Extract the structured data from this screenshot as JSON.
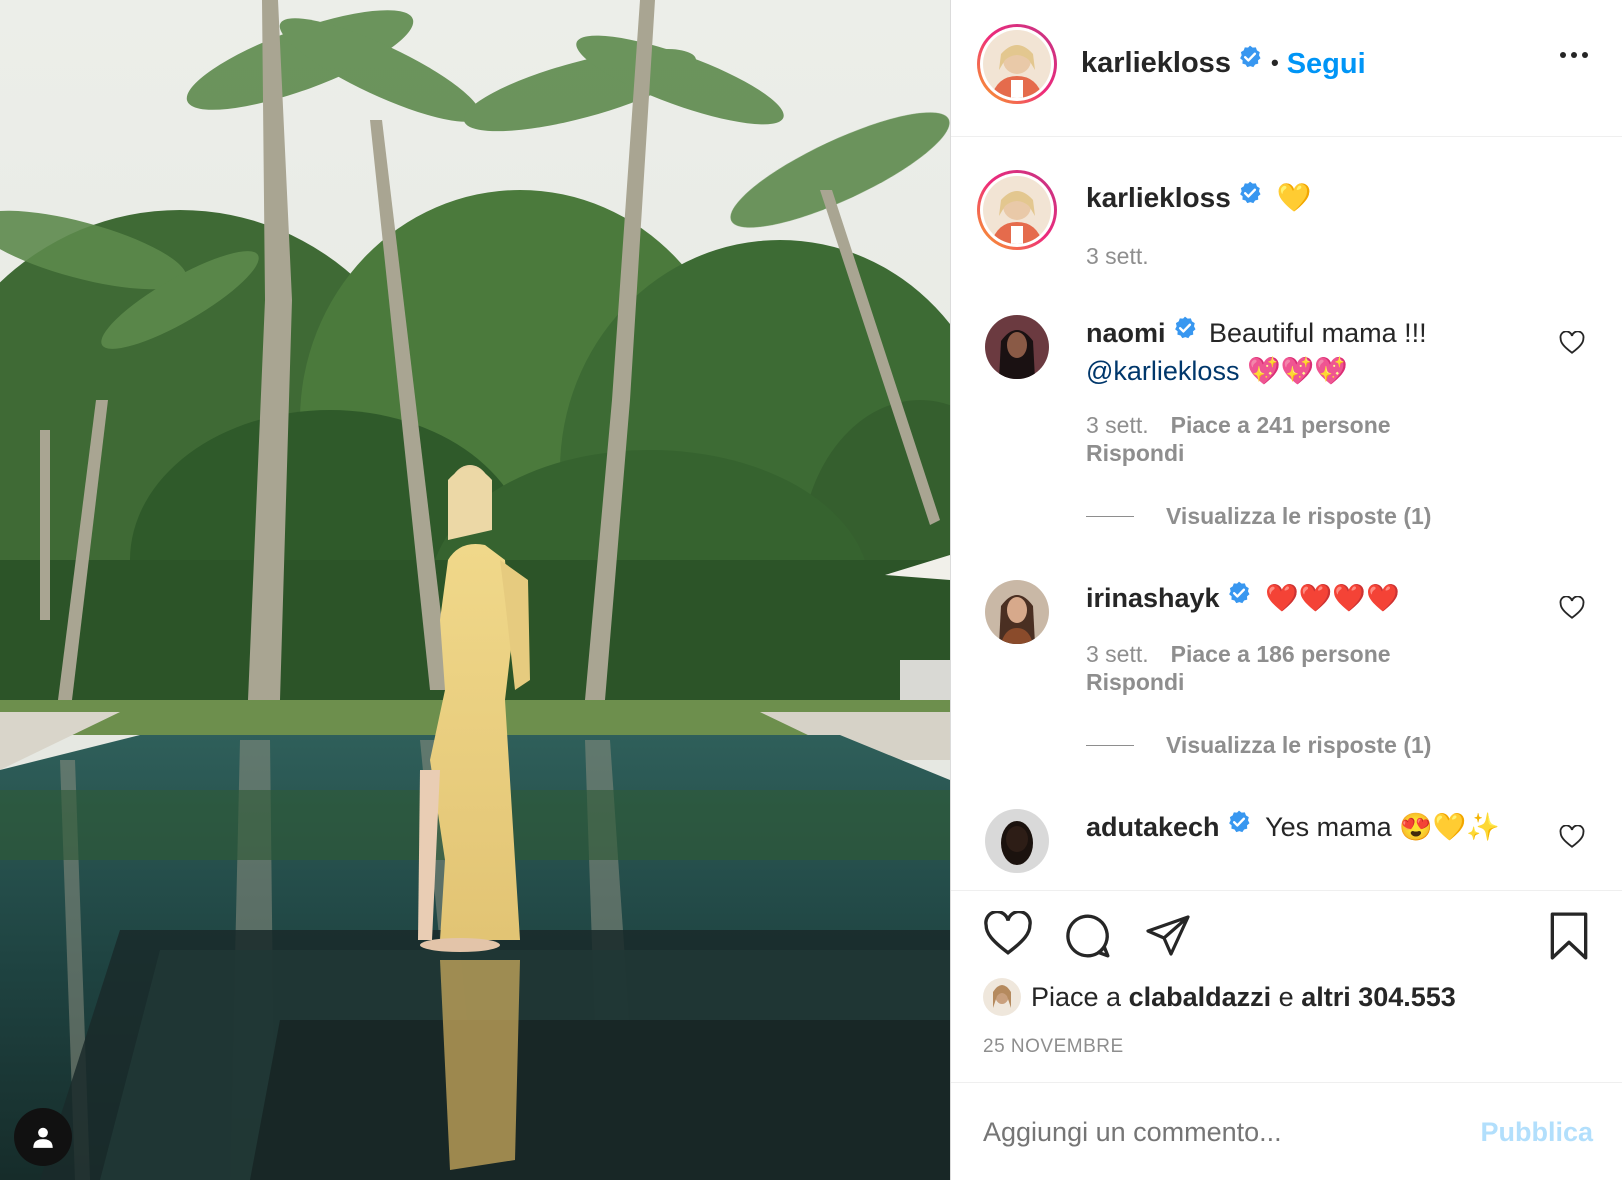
{
  "photo": {
    "alt_icon": "person-icon"
  },
  "header": {
    "username": "karliekloss",
    "separator": "•",
    "follow_label": "Segui"
  },
  "caption": {
    "username": "karliekloss",
    "text": "💛",
    "time": "3 sett."
  },
  "comments": [
    {
      "username": "naomi",
      "text_line1": "Beautiful mama !!!",
      "mention": "@karliekloss",
      "text_tail": "💖💖💖",
      "time": "3 sett.",
      "likes": "Piace a 241 persone",
      "reply_label": "Rispondi",
      "view_replies": "Visualizza le risposte (1)"
    },
    {
      "username": "irinashayk",
      "text_line1": "❤️❤️❤️❤️",
      "time": "3 sett.",
      "likes": "Piace a 186 persone",
      "reply_label": "Rispondi",
      "view_replies": "Visualizza le risposte (1)"
    },
    {
      "username": "adutakech",
      "text_line1": "Yes mama 😍💛✨"
    }
  ],
  "likes": {
    "prefix": "Piace a",
    "user": "clabaldazzi",
    "middle": "e",
    "others": "altri 304.553"
  },
  "date": "25 NOVEMBRE",
  "add_comment": {
    "placeholder": "Aggiungi un commento...",
    "post_label": "Pubblica"
  },
  "colors": {
    "link_blue": "#0095f6",
    "verified_blue": "#3897f0",
    "muted": "#8e8e8e",
    "post_disabled": "#b2dffc"
  }
}
